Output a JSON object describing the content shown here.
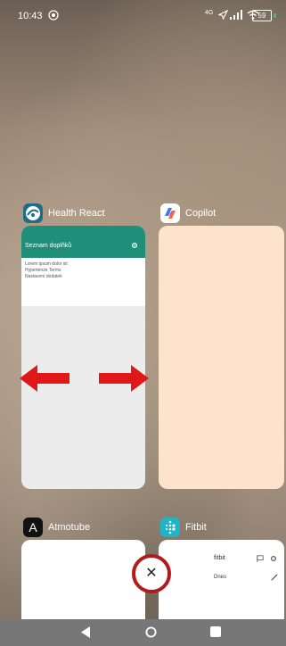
{
  "status_bar": {
    "time": "10:43",
    "network_type": "4G",
    "battery": "59"
  },
  "apps": {
    "health_react": {
      "name": "Health React",
      "screen_title": "Seznam doplňků",
      "lines": [
        "Lorem ipsum dolor sit",
        "Hypertenze Terms",
        "Nastavení dodatek"
      ]
    },
    "copilot": {
      "name": "Copilot"
    },
    "atmotube": {
      "name": "Atmotube",
      "icon_letter": "A"
    },
    "fitbit": {
      "name": "Fitbit",
      "brand": "fitbit",
      "label": "Dnes"
    }
  },
  "icons": [
    "settings-icon",
    "close-icon",
    "back-icon",
    "home-icon",
    "recents-icon",
    "arrow-left-icon",
    "arrow-right-icon"
  ],
  "colors": {
    "health_react_bar": "#1f8f7a",
    "copilot_card": "#fde3cc",
    "close_ring": "#b21b1b",
    "arrows": "#e01818",
    "battery_tip": "#3bc35a"
  }
}
